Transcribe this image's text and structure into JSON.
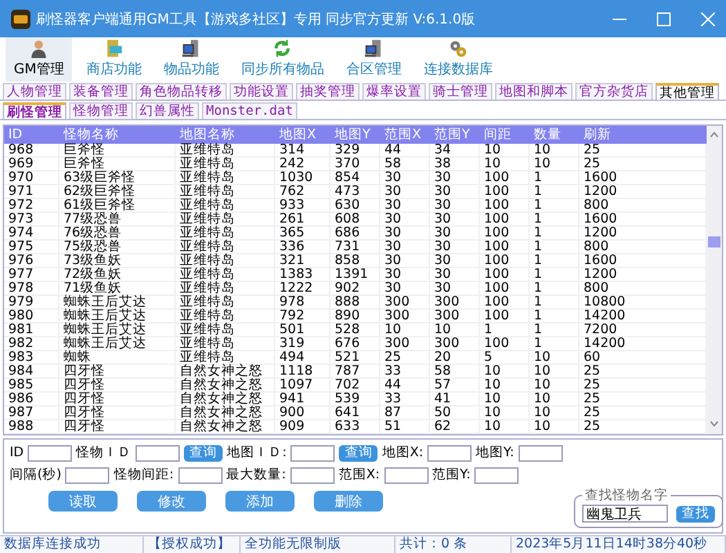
{
  "window": {
    "title": "刷怪器客户端通用GM工具【游戏多社区】专用 同步官方更新 V:6.1.0版"
  },
  "toolbar": [
    {
      "label": "GM管理",
      "selected": true
    },
    {
      "label": "商店功能",
      "selected": false
    },
    {
      "label": "物品功能",
      "selected": false
    },
    {
      "label": "同步所有物品",
      "selected": false
    },
    {
      "label": "合区管理",
      "selected": false
    },
    {
      "label": "连接数据库",
      "selected": false
    }
  ],
  "main_tabs": [
    {
      "label": "人物管理",
      "selected": false
    },
    {
      "label": "装备管理",
      "selected": false
    },
    {
      "label": "角色物品转移",
      "selected": false
    },
    {
      "label": "功能设置",
      "selected": false
    },
    {
      "label": "抽奖管理",
      "selected": false
    },
    {
      "label": "爆率设置",
      "selected": false
    },
    {
      "label": "骑士管理",
      "selected": false
    },
    {
      "label": "地图和脚本",
      "selected": false
    },
    {
      "label": "官方杂货店",
      "selected": false
    },
    {
      "label": "其他管理",
      "selected": true
    }
  ],
  "sub_tabs": [
    {
      "label": "刷怪管理",
      "selected": true
    },
    {
      "label": "怪物管理",
      "selected": false
    },
    {
      "label": "幻兽属性",
      "selected": false
    },
    {
      "label": "Monster.dat",
      "selected": false
    }
  ],
  "table": {
    "columns": [
      "ID",
      "怪物名称",
      "地图名称",
      "地图X",
      "地图Y",
      "范围X",
      "范围Y",
      "间距",
      "数量",
      "刷新"
    ],
    "rows": [
      [
        "968",
        "巨斧怪",
        "亚维特岛",
        "314",
        "329",
        "44",
        "34",
        "10",
        "10",
        "25"
      ],
      [
        "969",
        "巨斧怪",
        "亚维特岛",
        "242",
        "370",
        "58",
        "38",
        "10",
        "10",
        "25"
      ],
      [
        "970",
        "63级巨斧怪",
        "亚维特岛",
        "1030",
        "854",
        "30",
        "30",
        "100",
        "1",
        "1600"
      ],
      [
        "971",
        "62级巨斧怪",
        "亚维特岛",
        "762",
        "473",
        "30",
        "30",
        "100",
        "1",
        "1200"
      ],
      [
        "972",
        "61级巨斧怪",
        "亚维特岛",
        "933",
        "630",
        "30",
        "30",
        "100",
        "1",
        "800"
      ],
      [
        "973",
        "77级恐兽",
        "亚维特岛",
        "261",
        "608",
        "30",
        "30",
        "100",
        "1",
        "1600"
      ],
      [
        "974",
        "76级恐兽",
        "亚维特岛",
        "365",
        "686",
        "30",
        "30",
        "100",
        "1",
        "1200"
      ],
      [
        "975",
        "75级恐兽",
        "亚维特岛",
        "336",
        "731",
        "30",
        "30",
        "100",
        "1",
        "800"
      ],
      [
        "976",
        "73级鱼妖",
        "亚维特岛",
        "321",
        "858",
        "30",
        "30",
        "100",
        "1",
        "1600"
      ],
      [
        "977",
        "72级鱼妖",
        "亚维特岛",
        "1383",
        "1391",
        "30",
        "30",
        "100",
        "1",
        "1200"
      ],
      [
        "978",
        "71级鱼妖",
        "亚维特岛",
        "1222",
        "902",
        "30",
        "30",
        "100",
        "1",
        "800"
      ],
      [
        "979",
        "蜘蛛王后艾达",
        "亚维特岛",
        "978",
        "888",
        "300",
        "300",
        "100",
        "1",
        "10800"
      ],
      [
        "980",
        "蜘蛛王后艾达",
        "亚维特岛",
        "792",
        "890",
        "300",
        "300",
        "100",
        "1",
        "14200"
      ],
      [
        "981",
        "蜘蛛王后艾达",
        "亚维特岛",
        "501",
        "528",
        "10",
        "10",
        "1",
        "1",
        "7200"
      ],
      [
        "982",
        "蜘蛛王后艾达",
        "亚维特岛",
        "319",
        "676",
        "300",
        "300",
        "100",
        "1",
        "14200"
      ],
      [
        "983",
        "蜘蛛",
        "亚维特岛",
        "494",
        "521",
        "25",
        "20",
        "5",
        "10",
        "60"
      ],
      [
        "984",
        "四牙怪",
        "自然女神之怒",
        "1118",
        "787",
        "33",
        "58",
        "10",
        "10",
        "25"
      ],
      [
        "985",
        "四牙怪",
        "自然女神之怒",
        "1097",
        "702",
        "44",
        "57",
        "10",
        "10",
        "25"
      ],
      [
        "986",
        "四牙怪",
        "自然女神之怒",
        "941",
        "539",
        "33",
        "41",
        "10",
        "10",
        "25"
      ],
      [
        "987",
        "四牙怪",
        "自然女神之怒",
        "900",
        "641",
        "87",
        "50",
        "10",
        "10",
        "25"
      ],
      [
        "988",
        "四牙怪",
        "自然女神之怒",
        "909",
        "633",
        "51",
        "62",
        "10",
        "10",
        "25"
      ]
    ]
  },
  "form": {
    "lines": [
      [
        {
          "kind": "field",
          "label": "ID"
        },
        {
          "kind": "field",
          "label": "怪物ＩＤ"
        },
        {
          "kind": "button",
          "label": "查询"
        },
        {
          "kind": "field",
          "label": "地图ＩＤ:"
        },
        {
          "kind": "button",
          "label": "查询"
        },
        {
          "kind": "field",
          "label": "地图X:"
        },
        {
          "kind": "field",
          "label": "地图Y:"
        }
      ],
      [
        {
          "kind": "field",
          "label": "间隔(秒)"
        },
        {
          "kind": "field",
          "label": "怪物间距:"
        },
        {
          "kind": "field",
          "label": "最大数量:"
        },
        {
          "kind": "field",
          "label": "范围X:"
        },
        {
          "kind": "field",
          "label": "范围Y:"
        }
      ]
    ],
    "actions": [
      "读取",
      "修改",
      "添加",
      "删除"
    ],
    "search": {
      "title": "查找怪物名字",
      "value": "幽鬼卫兵",
      "button": "查找"
    }
  },
  "status_bar": [
    "数据库连接成功",
    "【授权成功】",
    "全功能无限制版",
    "共计：0 条",
    "2023年5月11日14时38分40秒"
  ]
}
